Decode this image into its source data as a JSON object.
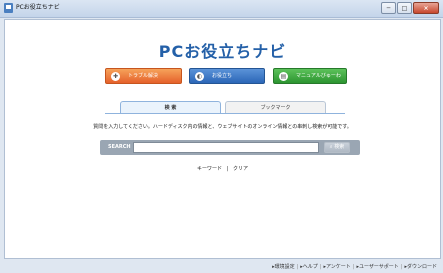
{
  "window": {
    "title": "PCお役立ちナビ",
    "min_label": "─",
    "max_label": "□",
    "close_label": "×"
  },
  "logo": "PCお役立ちナビ",
  "nav": {
    "trouble": {
      "label": "トラブル解決",
      "icon": "tools-icon"
    },
    "otasuke": {
      "label": "お役立ち",
      "icon": "info-icon"
    },
    "manual": {
      "label": "マニュアルびゅーわ",
      "icon": "manual-icon"
    }
  },
  "tabs": {
    "search": "検 索",
    "bookmark": "ブックマーク"
  },
  "description": "質問を入力してください。ハードディスク内の情報と、ウェブサイトのオンライン情報との串刺し検索が可能です。",
  "search": {
    "label": "SEARCH",
    "value": "",
    "placeholder": "",
    "button": "検索"
  },
  "links": {
    "keyword": "キーワード",
    "separator": "|",
    "clear": "クリア"
  },
  "footer": {
    "items": [
      "▸環境設定",
      "▸ヘルプ",
      "▸アンケート",
      "▸ユーザーサポート",
      "▸ダウンロード"
    ],
    "separator": "|"
  },
  "colors": {
    "trouble": "#e5612b",
    "otasuke": "#2b66b7",
    "manual": "#2c9430",
    "logo": "#2460a8"
  }
}
